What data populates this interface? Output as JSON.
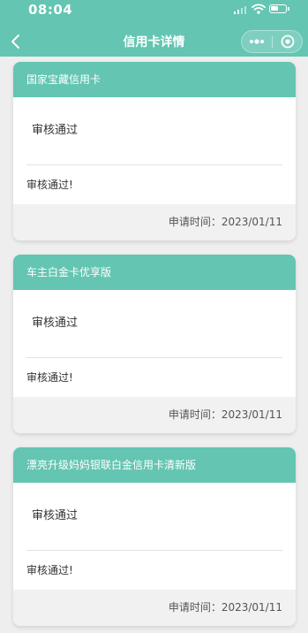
{
  "status_bar": {
    "time": "08:04"
  },
  "nav": {
    "title": "信用卡详情"
  },
  "cards": [
    {
      "name": "国家宝藏信用卡",
      "status": "审核通过",
      "note": "审核通过!",
      "apply_time": "申请时间：2023/01/11"
    },
    {
      "name": "车主白金卡优享版",
      "status": "审核通过",
      "note": "审核通过!",
      "apply_time": "申请时间：2023/01/11"
    },
    {
      "name": "漂亮升级妈妈银联白金信用卡清新版",
      "status": "审核通过",
      "note": "审核通过!",
      "apply_time": "申请时间：2023/01/11"
    }
  ],
  "colors": {
    "primary": "#63c5b2",
    "page_bg": "#eeeeee",
    "footer_bg": "#f1f1f1"
  },
  "icons": {
    "back": "chevron-left-icon",
    "more": "more-dots-icon",
    "close": "target-circle-icon",
    "signal": "signal-icon",
    "wifi": "wifi-icon",
    "battery": "battery-icon"
  }
}
